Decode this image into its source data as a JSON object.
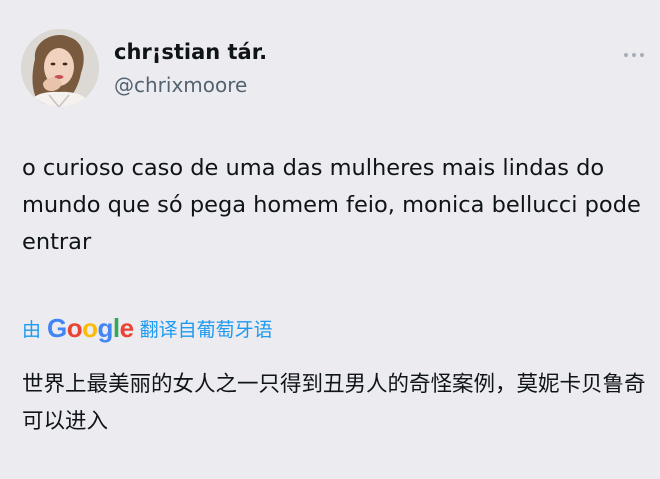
{
  "author": {
    "display_name": "chr¡stian tár.",
    "handle": "@chrixmoore",
    "avatar_icon": "profile-photo"
  },
  "more_icon": "ellipsis-icon",
  "tweet": {
    "text": "o curioso caso de uma das mulheres mais lindas do mundo que só pega homem feio, monica bellucci pode entrar"
  },
  "translation": {
    "prefix": "由",
    "provider_letters": [
      "G",
      "o",
      "o",
      "g",
      "l",
      "e"
    ],
    "suffix": "翻译自葡萄牙语",
    "text": "世界上最美丽的女人之一只得到丑男人的奇怪案例，莫妮卡贝鲁奇可以进入"
  },
  "colors": {
    "background": "#ecebf0",
    "link": "#1d9bf0",
    "secondary_text": "#536471",
    "google_blue": "#4285f4",
    "google_red": "#ea4335",
    "google_yellow": "#fbbc05",
    "google_green": "#34a853"
  }
}
